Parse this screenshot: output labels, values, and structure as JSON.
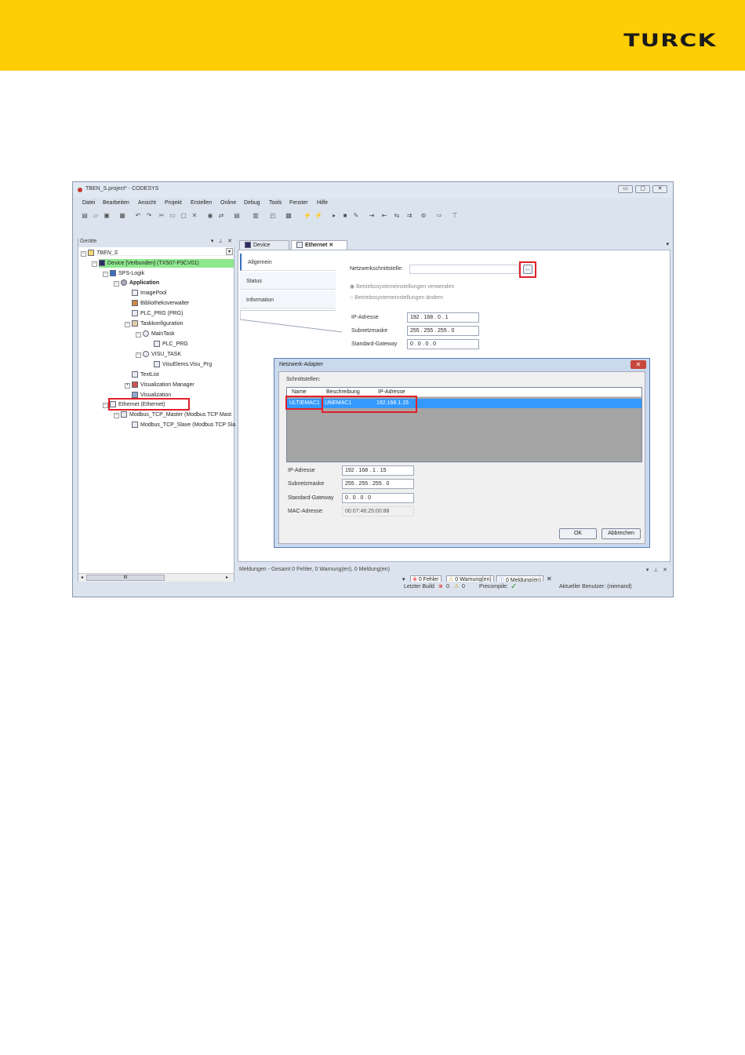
{
  "brand": {
    "logo_text": "TURCK",
    "banner_color": "#fecd05"
  },
  "window": {
    "title": "TBEN_S.project* - CODESYS",
    "controls": {
      "minimize": "▭",
      "maximize": "▢",
      "close": "✕"
    }
  },
  "menu": [
    "Datei",
    "Bearbeiten",
    "Ansicht",
    "Projekt",
    "Erstellen",
    "Online",
    "Debug",
    "Tools",
    "Fenster",
    "Hilfe"
  ],
  "devices_panel": {
    "title": "Geräte",
    "controls": {
      "dropdown": "▾",
      "pin": "⊥",
      "close": "✕"
    },
    "tree": [
      {
        "label": "TBEN_S",
        "level": 0,
        "icon": "project-icon"
      },
      {
        "label": "Device [Verbunden] (TX507-P3CV01)",
        "level": 1,
        "icon": "device-icon",
        "highlight": true
      },
      {
        "label": "SPS-Logik",
        "level": 2,
        "icon": "plc-logic-icon"
      },
      {
        "label": "Application",
        "level": 3,
        "icon": "application-icon",
        "bold": true
      },
      {
        "label": "ImagePool",
        "level": 4,
        "icon": "imagepool-icon"
      },
      {
        "label": "Bibliotheksverwalter",
        "level": 4,
        "icon": "library-icon"
      },
      {
        "label": "PLC_PRG (PRG)",
        "level": 4,
        "icon": "program-icon"
      },
      {
        "label": "Taskkonfiguration",
        "level": 4,
        "icon": "task-config-icon"
      },
      {
        "label": "MainTask",
        "level": 5,
        "icon": "task-icon"
      },
      {
        "label": "PLC_PRG",
        "level": 6,
        "icon": "program-call-icon"
      },
      {
        "label": "VISU_TASK",
        "level": 5,
        "icon": "task-icon"
      },
      {
        "label": "VisuElems.Visu_Prg",
        "level": 6,
        "icon": "program-call-icon"
      },
      {
        "label": "TextList",
        "level": 4,
        "icon": "textlist-icon"
      },
      {
        "label": "Visualization Manager",
        "level": 4,
        "icon": "visu-manager-icon"
      },
      {
        "label": "Visualization",
        "level": 4,
        "icon": "visualization-icon"
      },
      {
        "label": "Ethernet (Ethernet)",
        "level": 2,
        "icon": "ethernet-icon",
        "boxed": true
      },
      {
        "label": "Modbus_TCP_Master (Modbus TCP Mast",
        "level": 3,
        "icon": "modbus-master-icon"
      },
      {
        "label": "Modbus_TCP_Slave (Modbus TCP Sla",
        "level": 4,
        "icon": "modbus-slave-icon"
      }
    ],
    "scroll_thumb": "III"
  },
  "editor_tabs": [
    {
      "label": "Device",
      "active": false
    },
    {
      "label": "Ethernet",
      "active": true,
      "close": "✕"
    }
  ],
  "editor_dropdown": "▾",
  "ethernet_editor": {
    "subnav": [
      "Allgemein",
      "Status",
      "Information"
    ],
    "netif_label": "Netzwerkschnittstelle:",
    "browse_button": "...",
    "radio_use": "Betriebssystemeinstellungen verwenden",
    "radio_change": "Betriebssystemeinstellungen ändern",
    "ip_label": "IP-Adresse",
    "ip_value": "192 . 168 . 0 . 1",
    "subnet_label": "Subnetzmaske",
    "subnet_value": "255 . 255 . 255 . 0",
    "gateway_label": "Standard-Gateway",
    "gateway_value": "0 . 0 . 0 . 0"
  },
  "dialog": {
    "title": "Netzwerk-Adapter",
    "close": "✕",
    "interfaces_label": "Schnittstellen:",
    "columns": [
      "Name",
      "Beschreibung",
      "IP-Adresse"
    ],
    "rows": [
      {
        "name": "ULTIEMAC1",
        "description": "UltiEMAC1",
        "ip": "192.168.1.15"
      }
    ],
    "ip_label": "IP-Adresse",
    "ip_value": "192 . 168 . 1 . 15",
    "subnet_label": "Subnetzmaske",
    "subnet_value": "255 . 255 . 255 . 0",
    "gateway_label": "Standard-Gateway",
    "gateway_value": "0 . 0 . 0 . 0",
    "mac_label": "MAC-Adresse:",
    "mac_value": "00:07:46:25:00:88",
    "ok_label": "OK",
    "cancel_label": "Abbrechen"
  },
  "messages": {
    "title": "Meldungen - Gesamt 0 Fehler, 0 Warnung(en), 0 Meldung(en)",
    "errors_tab": "0 Fehler",
    "warnings_tab": "0 Warnung(en)",
    "messages_tab": "0 Meldung(en)",
    "controls": {
      "dropdown": "▾",
      "pin": "⊥",
      "close": "✕"
    }
  },
  "statusbar": {
    "last_build_label": "Letzter Build",
    "error_count": "0",
    "warning_count": "0",
    "precompile_label": "Precompile:",
    "precompile_ok": "✓",
    "user_text": "Aktueller Benutzer: (niemand)"
  }
}
